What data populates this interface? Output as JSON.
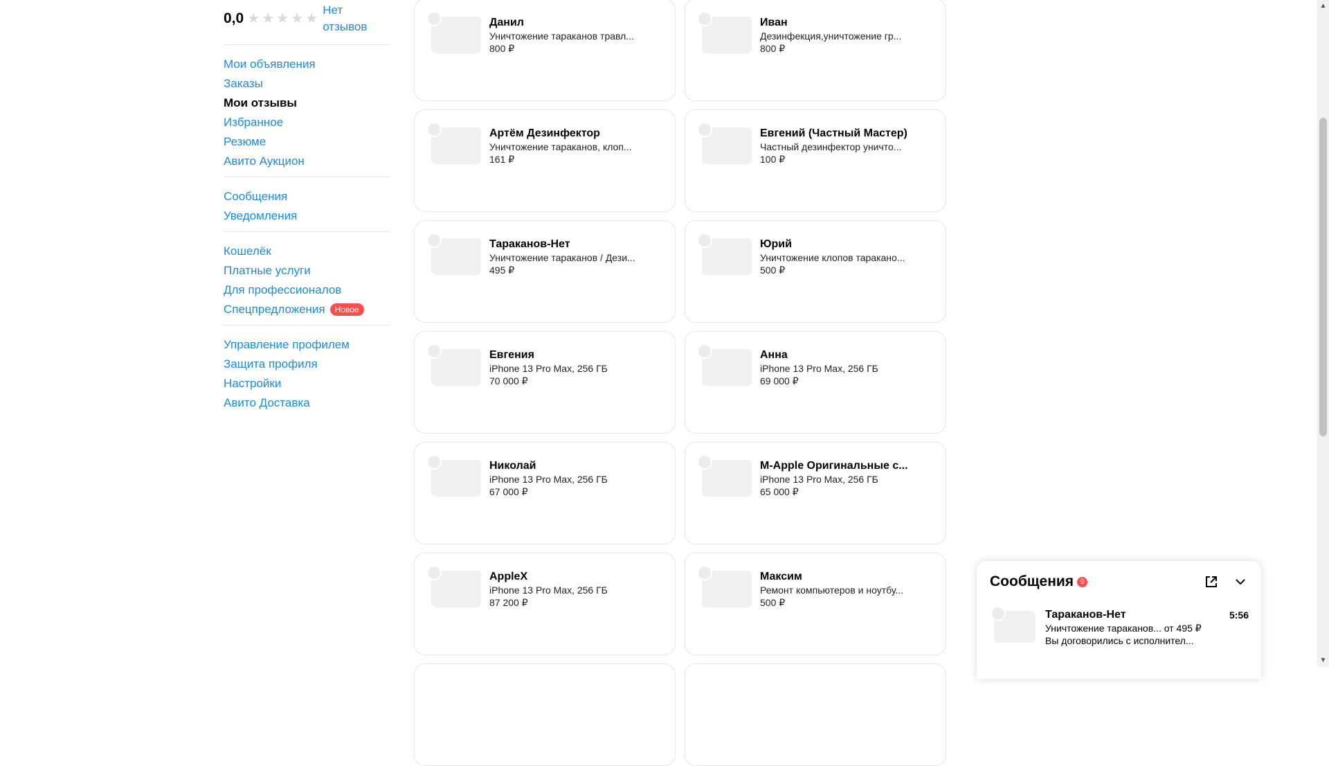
{
  "sidebar": {
    "rating_value": "0,0",
    "no_reviews_line1": "Нет",
    "no_reviews_line2": "отзывов",
    "groups": [
      [
        {
          "label": "Мои объявления",
          "active": false
        },
        {
          "label": "Заказы",
          "active": false
        },
        {
          "label": "Мои отзывы",
          "active": true
        },
        {
          "label": "Избранное",
          "active": false
        },
        {
          "label": "Резюме",
          "active": false
        },
        {
          "label": "Авито Аукцион",
          "active": false
        }
      ],
      [
        {
          "label": "Сообщения",
          "active": false
        },
        {
          "label": "Уведомления",
          "active": false
        }
      ],
      [
        {
          "label": "Кошелёк",
          "active": false
        },
        {
          "label": "Платные услуги",
          "active": false
        },
        {
          "label": "Для профессионалов",
          "active": false
        },
        {
          "label": "Спецпредложения",
          "active": false,
          "badge": "Новое"
        }
      ],
      [
        {
          "label": "Управление профилем",
          "active": false
        },
        {
          "label": "Защита профиля",
          "active": false
        },
        {
          "label": "Настройки",
          "active": false
        },
        {
          "label": "Авито Доставка",
          "active": false
        }
      ]
    ]
  },
  "cards": [
    {
      "name": "Данил",
      "desc": "Уничтожение тараканов травл...",
      "price": "800 ₽"
    },
    {
      "name": "Иван",
      "desc": "Дезинфекция,уничтожение гр...",
      "price": "800 ₽"
    },
    {
      "name": "Артём Дезинфектор",
      "desc": "Уничтожение тараканов, клоп...",
      "price": "161 ₽"
    },
    {
      "name": "Евгений (Частный Мастер)",
      "desc": "Частный дезинфектор уничто...",
      "price": "100 ₽"
    },
    {
      "name": "Тараканов-Нет",
      "desc": "Уничтожение тараканов / Дези...",
      "price": "495 ₽"
    },
    {
      "name": "Юрий",
      "desc": "Уничтожение клопов таракано...",
      "price": "500 ₽"
    },
    {
      "name": "Евгения",
      "desc": "iPhone 13 Pro Max, 256 ГБ",
      "price": "70 000 ₽"
    },
    {
      "name": "Анна",
      "desc": "iPhone 13 Pro Max, 256 ГБ",
      "price": "69 000 ₽"
    },
    {
      "name": "Николай",
      "desc": "iPhone 13 Pro Max, 256 ГБ",
      "price": "67 000 ₽"
    },
    {
      "name": "M-Apple Оригинальные с...",
      "desc": "iPhone 13 Pro Max, 256 ГБ",
      "price": "65 000 ₽"
    },
    {
      "name": "AppleX",
      "desc": "iPhone 13 Pro Max, 256 ГБ",
      "price": "87 200 ₽"
    },
    {
      "name": "Максим",
      "desc": "Ремонт компьютеров и ноутбу...",
      "price": "500 ₽"
    }
  ],
  "messages_widget": {
    "title": "Сообщения",
    "count": "9",
    "item": {
      "name": "Тараканов-Нет",
      "line1": "Уничтожение тараканов... от 495 ₽",
      "line2": "Вы договорились с исполнител...",
      "time": "5:56"
    }
  },
  "colors": {
    "link": "#1a8cd8",
    "badge": "#ff4d4d",
    "star_empty": "#d9d9d9"
  }
}
